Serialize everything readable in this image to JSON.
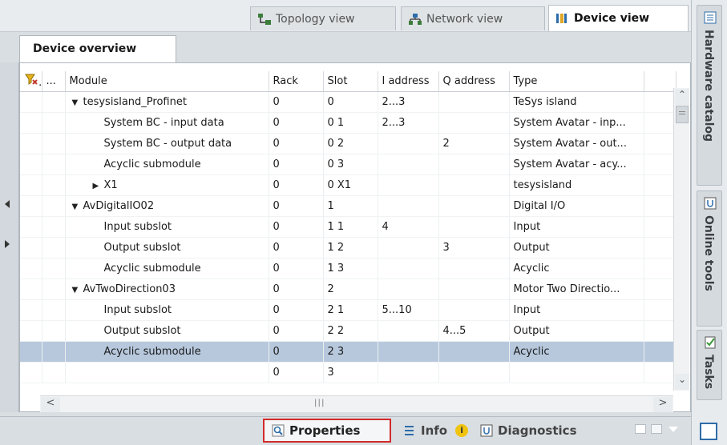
{
  "view_tabs": [
    {
      "label": "Topology view"
    },
    {
      "label": "Network view"
    },
    {
      "label": "Device view"
    }
  ],
  "overview": {
    "tab_label": "Device overview",
    "headers": [
      "",
      "...",
      "Module",
      "Rack",
      "Slot",
      "I address",
      "Q address",
      "Type",
      ""
    ],
    "rows": [
      {
        "indent": 1,
        "arrow": "down",
        "module": "tesysisland_Profinet",
        "rack": "0",
        "slot": "0",
        "i_address": "2...3",
        "q_address": "",
        "type": "TeSys island"
      },
      {
        "indent": 2,
        "arrow": "",
        "module": "System BC - input data",
        "rack": "0",
        "slot": "0 1",
        "i_address": "2...3",
        "q_address": "",
        "type": "System Avatar - inp..."
      },
      {
        "indent": 2,
        "arrow": "",
        "module": "System BC - output data",
        "rack": "0",
        "slot": "0 2",
        "i_address": "",
        "q_address": "2",
        "type": "System Avatar - out..."
      },
      {
        "indent": 2,
        "arrow": "",
        "module": "Acyclic submodule",
        "rack": "0",
        "slot": "0 3",
        "i_address": "",
        "q_address": "",
        "type": "System Avatar - acy..."
      },
      {
        "indent": 2,
        "arrow": "right",
        "module": "X1",
        "rack": "0",
        "slot": "0 X1",
        "i_address": "",
        "q_address": "",
        "type": "tesysisland"
      },
      {
        "indent": 1,
        "arrow": "down",
        "module": "AvDigitalIO02",
        "rack": "0",
        "slot": "1",
        "i_address": "",
        "q_address": "",
        "type": "Digital I/O"
      },
      {
        "indent": 2,
        "arrow": "",
        "module": "Input subslot",
        "rack": "0",
        "slot": "1 1",
        "i_address": "4",
        "q_address": "",
        "type": "Input"
      },
      {
        "indent": 2,
        "arrow": "",
        "module": "Output subslot",
        "rack": "0",
        "slot": "1 2",
        "i_address": "",
        "q_address": "3",
        "type": "Output"
      },
      {
        "indent": 2,
        "arrow": "",
        "module": "Acyclic submodule",
        "rack": "0",
        "slot": "1 3",
        "i_address": "",
        "q_address": "",
        "type": "Acyclic"
      },
      {
        "indent": 1,
        "arrow": "down",
        "module": "AvTwoDirection03",
        "rack": "0",
        "slot": "2",
        "i_address": "",
        "q_address": "",
        "type": "Motor Two Directio..."
      },
      {
        "indent": 2,
        "arrow": "",
        "module": "Input subslot",
        "rack": "0",
        "slot": "2 1",
        "i_address": "5...10",
        "q_address": "",
        "type": "Input"
      },
      {
        "indent": 2,
        "arrow": "",
        "module": "Output subslot",
        "rack": "0",
        "slot": "2 2",
        "i_address": "",
        "q_address": "4...5",
        "type": "Output"
      },
      {
        "indent": 2,
        "arrow": "",
        "module": "Acyclic submodule",
        "rack": "0",
        "slot": "2 3",
        "i_address": "",
        "q_address": "",
        "type": "Acyclic",
        "selected": true
      },
      {
        "indent": 1,
        "arrow": "",
        "module": "",
        "rack": "0",
        "slot": "3",
        "i_address": "",
        "q_address": "",
        "type": ""
      }
    ]
  },
  "sidebar": {
    "hardware_catalog": "Hardware catalog",
    "online_tools": "Online tools",
    "tasks": "Tasks"
  },
  "bottom_tabs": {
    "properties": "Properties",
    "info": "Info",
    "diagnostics": "Diagnostics"
  },
  "colors": {
    "selection": "#b7c8dd",
    "highlight_border": "#d12b2b",
    "info_badge": "#f1c40f"
  }
}
